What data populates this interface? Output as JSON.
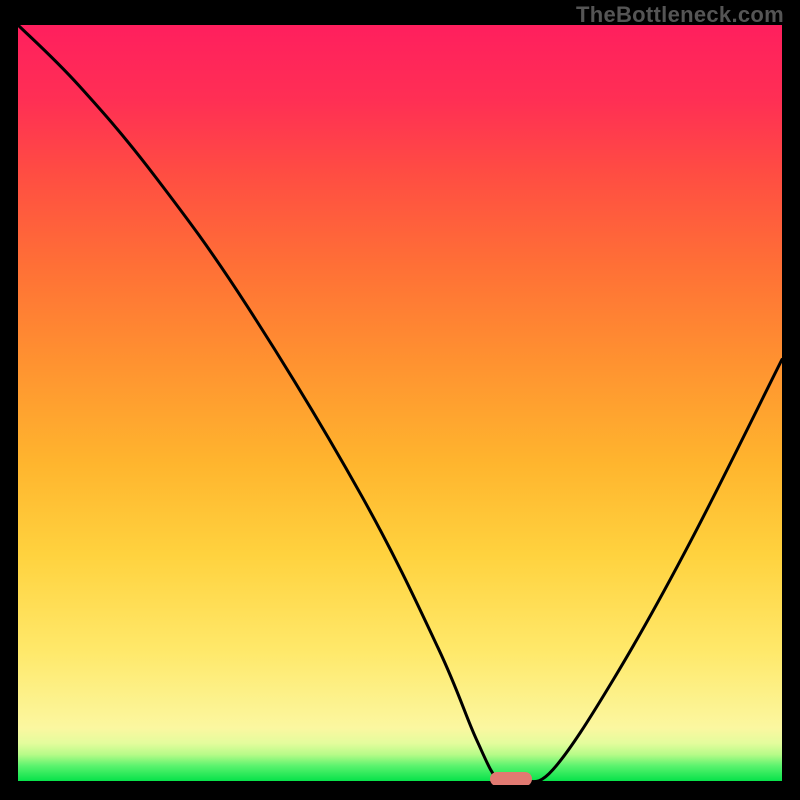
{
  "watermark": "TheBottleneck.com",
  "colors": {
    "background": "#000000",
    "marker": "#e17971",
    "curve": "#000000"
  },
  "chart_data": {
    "type": "line",
    "title": "",
    "xlabel": "",
    "ylabel": "",
    "xlim": [
      0,
      100
    ],
    "ylim": [
      0,
      100
    ],
    "background_gradient": {
      "direction": "vertical",
      "stops": [
        {
          "pos": 0,
          "color": "#07e24a"
        },
        {
          "pos": 7,
          "color": "#fbf7a0"
        },
        {
          "pos": 30,
          "color": "#ffd23e"
        },
        {
          "pos": 55,
          "color": "#ff9330"
        },
        {
          "pos": 80,
          "color": "#ff4e42"
        },
        {
          "pos": 100,
          "color": "#ff1f5e"
        }
      ]
    },
    "series": [
      {
        "name": "bottleneck-curve",
        "x": [
          0,
          8,
          18,
          30,
          45,
          55,
          60,
          63,
          66,
          70,
          78,
          88,
          100
        ],
        "y": [
          100,
          92,
          80,
          63,
          38,
          18,
          6,
          0.5,
          0.5,
          2,
          14,
          32,
          56
        ]
      }
    ],
    "marker": {
      "x": 64.5,
      "y": 0.8
    }
  }
}
